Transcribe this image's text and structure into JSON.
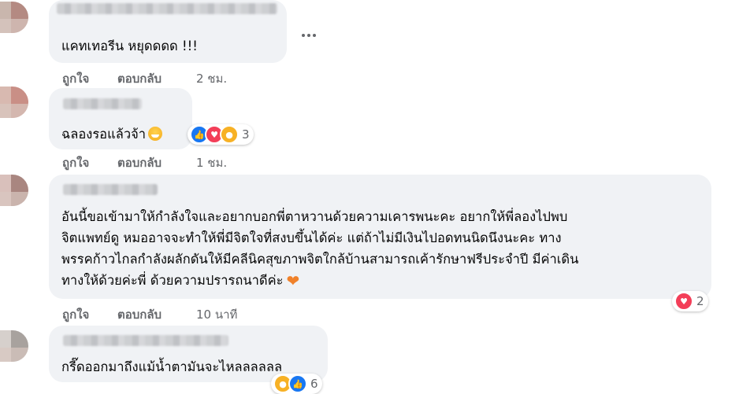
{
  "comments": [
    {
      "text": "แคทเทอรีน หยุดดดด !!!",
      "like_label": "ถูกใจ",
      "reply_label": "ตอบกลับ",
      "time": "2 ชม."
    },
    {
      "text": "ฉลองรอแล้วจ้า",
      "emoji": "grinning-face-emoji",
      "reactions": [
        "like",
        "love",
        "haha"
      ],
      "reaction_count": "3",
      "like_label": "ถูกใจ",
      "reply_label": "ตอบกลับ",
      "time": "1 ชม."
    },
    {
      "lines": [
        "อันนี้ขอเข้ามาให้กำลังใจและอยากบอกพี่ตาหวานด้วยความเคารพนะคะ อยากให้พี่ลองไปพบ",
        "จิตแพทย์ดู หมออาจจะทำให้พี่มีจิตใจที่สงบขึ้นได้ค่ะ แต่ถ้าไม่มีเงินไปอดทนนิดนึงนะคะ ทาง",
        "พรรคก้าวไกลกำลังผลักดันให้มีคลีนิคสุขภาพจิตใกล้บ้านสามารถเค้ารักษาฟรีประจำปี มีค่าเดิน",
        "ทางให้ด้วยค่ะพี่ ด้วยความปรารถนาดีค่ะ"
      ],
      "emoji": "orange-heart-emoji",
      "reactions": [
        "love"
      ],
      "reaction_count": "2",
      "like_label": "ถูกใจ",
      "reply_label": "ตอบกลับ",
      "time": "10 นาที"
    },
    {
      "text": "กรี๊ดออกมาถึงแม้น้ำตามันจะไหลลลลลล",
      "reactions": [
        "haha",
        "like"
      ],
      "reaction_count": "6"
    }
  ],
  "colors": {
    "bubble": "#f0f2f5",
    "meta_text": "#65676b",
    "like_blue": "#1877f2",
    "love_red": "#f33e58",
    "haha_yellow": "#f7b125"
  }
}
